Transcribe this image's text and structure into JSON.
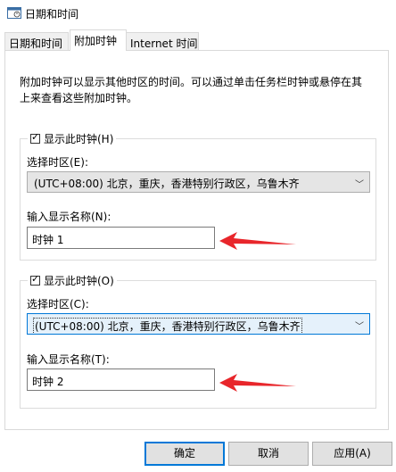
{
  "window": {
    "title": "日期和时间",
    "icon": "clock-calendar-icon"
  },
  "tabs": [
    {
      "label": "日期和时间",
      "active": false
    },
    {
      "label": "附加时钟",
      "active": true
    },
    {
      "label": "Internet 时间",
      "active": false
    }
  ],
  "description": "附加时钟可以显示其他时区的时间。可以通过单击任务栏时钟或悬停在其上来查看这些附加时钟。",
  "clock1": {
    "checkbox_label": "显示此时钟(H)",
    "checked": true,
    "timezone_label": "选择时区(E):",
    "timezone_value": "(UTC+08:00) 北京，重庆，香港特别行政区，乌鲁木齐",
    "name_label": "输入显示名称(N):",
    "name_value": "时钟 1"
  },
  "clock2": {
    "checkbox_label": "显示此时钟(O)",
    "checked": true,
    "timezone_label": "选择时区(C):",
    "timezone_value": "(UTC+08:00) 北京，重庆，香港特别行政区，乌鲁木齐",
    "name_label": "输入显示名称(T):",
    "name_value": "时钟 2"
  },
  "buttons": {
    "ok": "确定",
    "cancel": "取消",
    "apply": "应用(A)"
  },
  "annotation_color": "#e8262b"
}
